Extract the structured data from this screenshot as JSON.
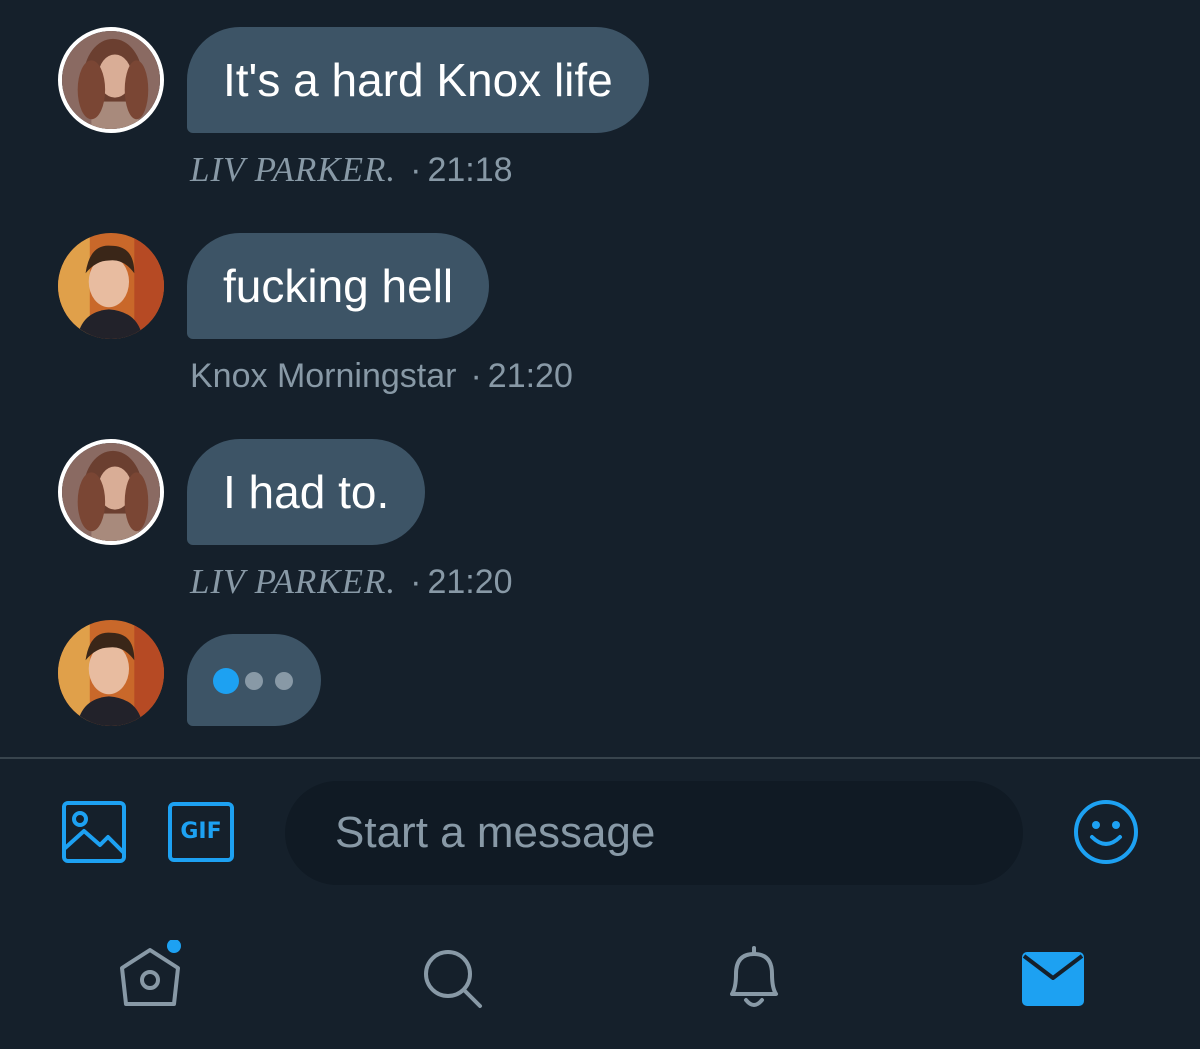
{
  "conversation": {
    "messages": [
      {
        "text": "It's a hard Knox life",
        "sender": "LIV PARKER.",
        "time": "21:18"
      },
      {
        "text": "fucking hell",
        "sender": "Knox Morningstar",
        "time": "21:20"
      },
      {
        "text": "I had to.",
        "sender": "LIV PARKER.",
        "time": "21:20"
      }
    ],
    "separator": "·"
  },
  "composer": {
    "placeholder": "Start a message",
    "gif_label": "GIF"
  },
  "colors": {
    "background": "#15202b",
    "bubble": "#3d5466",
    "accent": "#1da1f2",
    "muted": "#8899a6",
    "input_bg": "#101a24"
  },
  "icons": {
    "composer": [
      "image-icon",
      "gif-icon",
      "emoji-icon"
    ],
    "nav": [
      "home-icon",
      "search-icon",
      "bell-icon",
      "mail-icon"
    ]
  }
}
